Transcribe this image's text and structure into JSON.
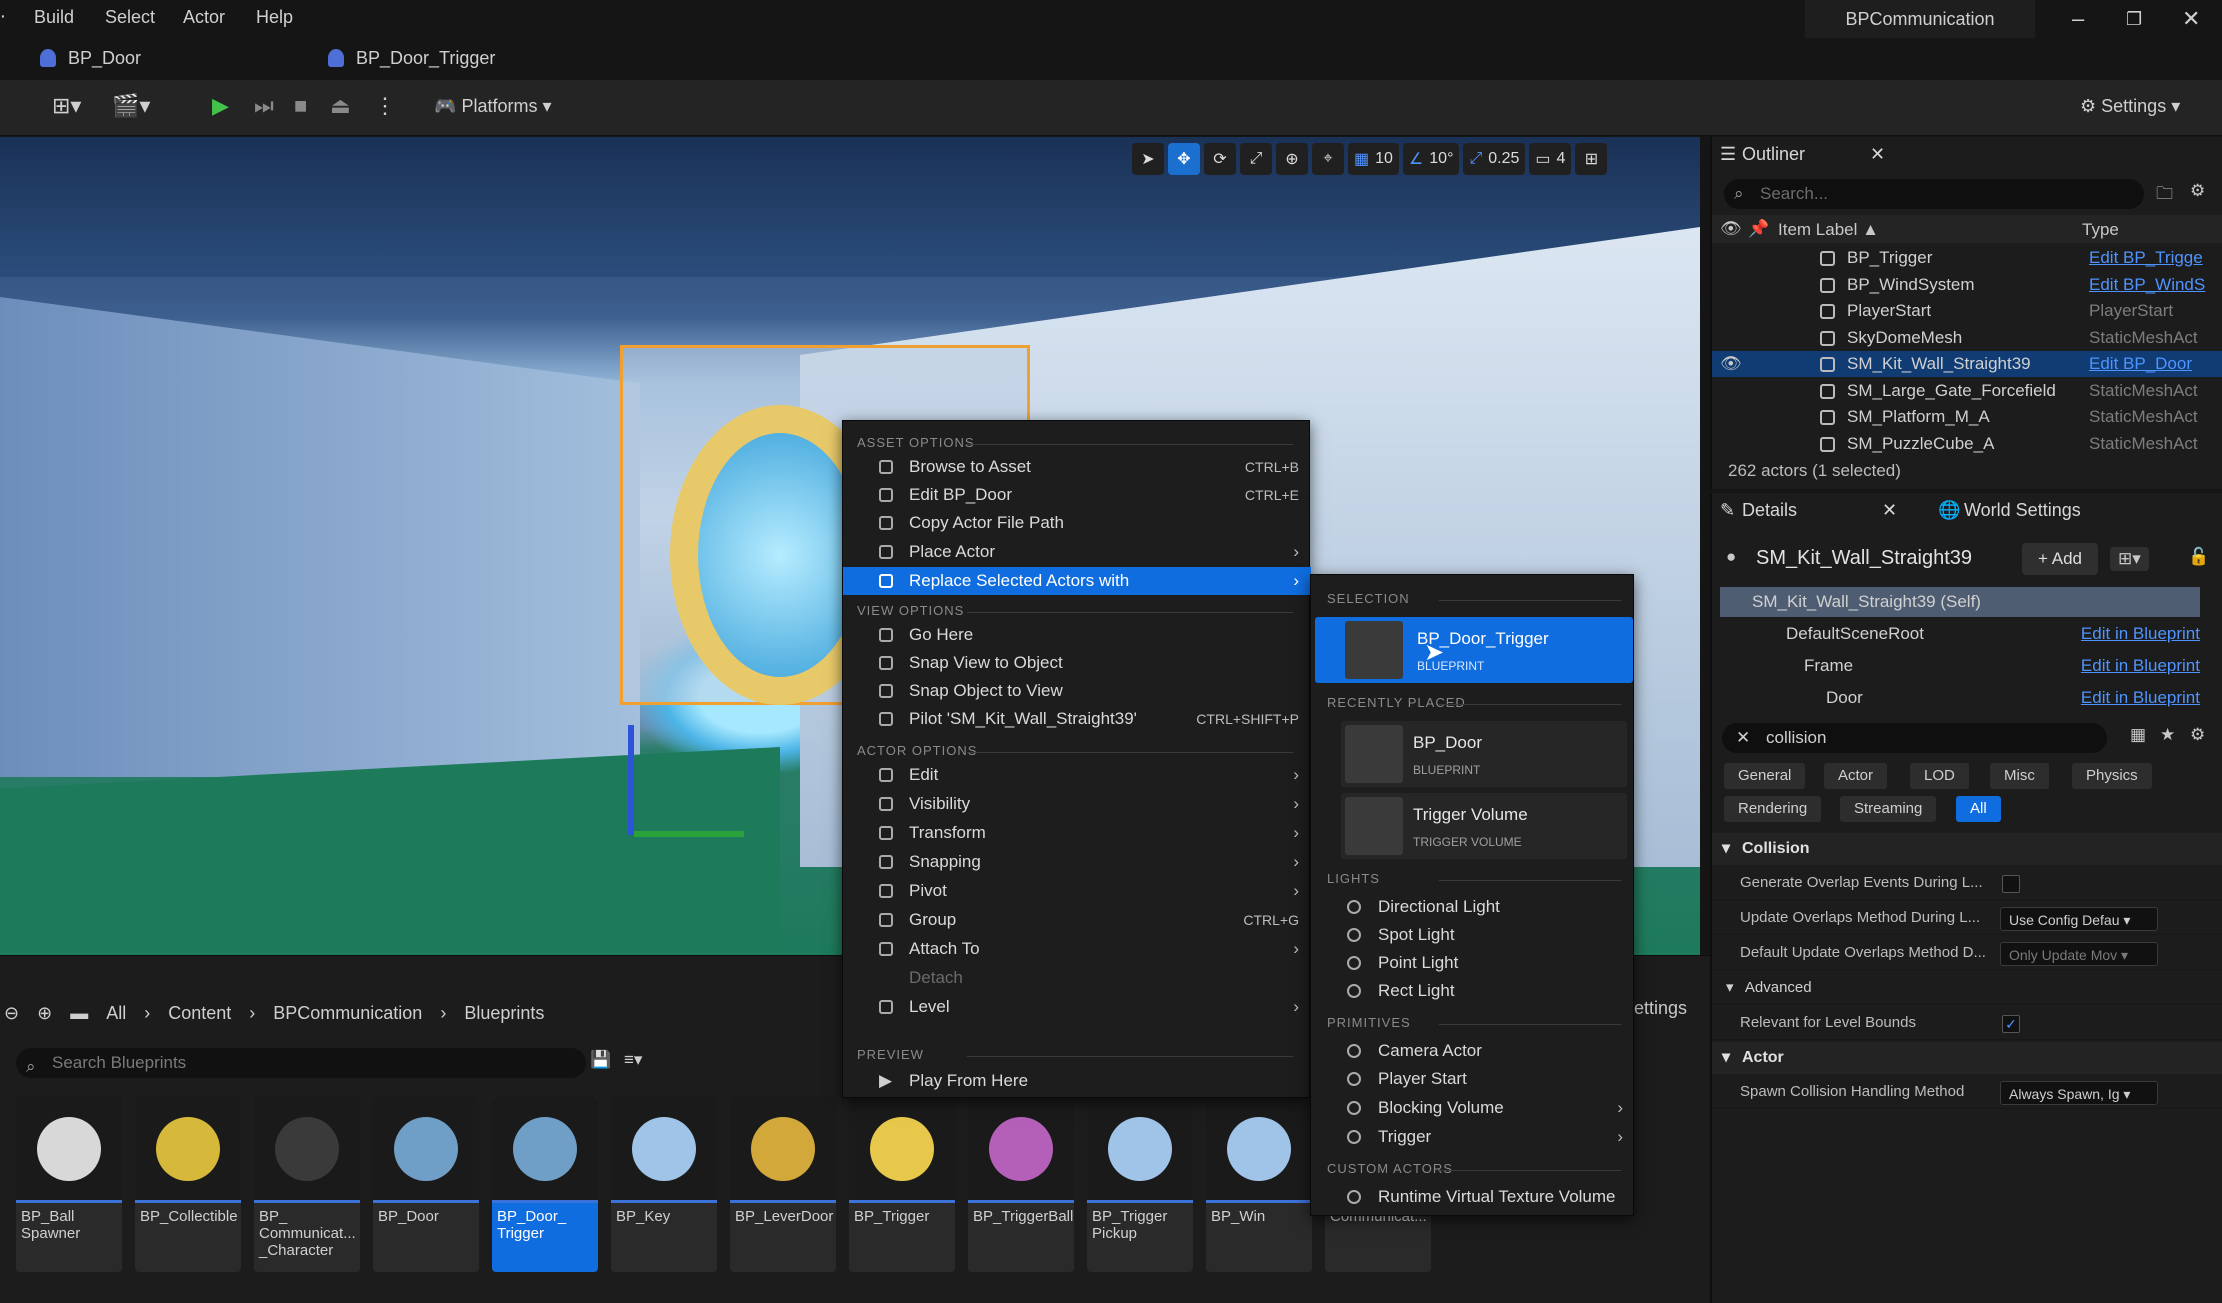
{
  "menubar": {
    "items": [
      "Build",
      "Select",
      "Actor",
      "Help"
    ],
    "project": "BPCommunication"
  },
  "tabs": [
    "BP_Door",
    "BP_Door_Trigger"
  ],
  "toolbar": {
    "platforms": "Platforms",
    "settings": "Settings"
  },
  "viewport_controls": {
    "grid": "10",
    "rotation": "10°",
    "scale": "0.25",
    "camera_speed": "4"
  },
  "context_menu": {
    "sections": {
      "asset": "ASSET OPTIONS",
      "view": "VIEW OPTIONS",
      "actor": "ACTOR OPTIONS",
      "preview": "PREVIEW"
    },
    "asset_items": [
      {
        "label": "Browse to Asset",
        "shortcut": "CTRL+B"
      },
      {
        "label": "Edit BP_Door",
        "shortcut": "CTRL+E"
      },
      {
        "label": "Copy Actor File Path",
        "shortcut": ""
      },
      {
        "label": "Place Actor",
        "shortcut": ""
      },
      {
        "label": "Replace Selected Actors with",
        "shortcut": ""
      }
    ],
    "view_items": [
      {
        "label": "Go Here",
        "shortcut": ""
      },
      {
        "label": "Snap View to Object",
        "shortcut": ""
      },
      {
        "label": "Snap Object to View",
        "shortcut": ""
      },
      {
        "label": "Pilot 'SM_Kit_Wall_Straight39'",
        "shortcut": "CTRL+SHIFT+P"
      }
    ],
    "actor_items": [
      {
        "label": "Edit",
        "shortcut": ""
      },
      {
        "label": "Visibility",
        "shortcut": ""
      },
      {
        "label": "Transform",
        "shortcut": ""
      },
      {
        "label": "Snapping",
        "shortcut": ""
      },
      {
        "label": "Pivot",
        "shortcut": ""
      },
      {
        "label": "Group",
        "shortcut": "CTRL+G"
      },
      {
        "label": "Attach To",
        "shortcut": ""
      },
      {
        "label": "Detach",
        "shortcut": ""
      },
      {
        "label": "Level",
        "shortcut": ""
      }
    ],
    "preview_items": [
      {
        "label": "Play From Here"
      }
    ]
  },
  "submenu": {
    "sections": {
      "selection": "SELECTION",
      "recent": "RECENTLY PLACED",
      "lights": "LIGHTS",
      "primitives": "PRIMITIVES",
      "custom": "CUSTOM ACTORS"
    },
    "selection_card": {
      "title": "BP_Door_Trigger",
      "sub": "BLUEPRINT"
    },
    "recent_cards": [
      {
        "title": "BP_Door",
        "sub": "BLUEPRINT"
      },
      {
        "title": "Trigger Volume",
        "sub": "TRIGGER VOLUME"
      }
    ],
    "lights": [
      "Directional Light",
      "Spot Light",
      "Point Light",
      "Rect Light"
    ],
    "primitives": [
      "Camera Actor",
      "Player Start",
      "Blocking Volume",
      "Trigger"
    ],
    "custom": [
      "Runtime Virtual Texture Volume"
    ]
  },
  "content_browser": {
    "breadcrumb": [
      "All",
      "Content",
      "BPCommunication",
      "Blueprints"
    ],
    "search_placeholder": "Search Blueprints",
    "settings_fragment": "ettings",
    "assets": [
      {
        "name": "BP_Ball Spawner",
        "color": "#d8d8d8"
      },
      {
        "name": "BP_Collectible",
        "color": "#d6b83a"
      },
      {
        "name": "BP_ Communicat... _Character",
        "color": "#3a3a3a"
      },
      {
        "name": "BP_Door",
        "color": "#6f9fc6"
      },
      {
        "name": "BP_Door_ Trigger",
        "color": "#6f9fc6"
      },
      {
        "name": "BP_Key",
        "color": "#9fc4e8"
      },
      {
        "name": "BP_LeverDoor",
        "color": "#d3a83a"
      },
      {
        "name": "BP_Trigger",
        "color": "#e7c84a"
      },
      {
        "name": "BP_TriggerBall",
        "color": "#b45fb8"
      },
      {
        "name": "BP_Trigger Pickup",
        "color": "#9fc4e8"
      },
      {
        "name": "BP_Win",
        "color": "#9fc4e8"
      },
      {
        "name": "Communicat...",
        "color": "#2a2a2a"
      }
    ]
  },
  "outliner": {
    "tab": "Outliner",
    "search_placeholder": "Search...",
    "col_label": "Item Label ▲",
    "col_type": "Type",
    "rows": [
      {
        "label": "BP_Trigger",
        "type": "Edit BP_Trigge",
        "link": true
      },
      {
        "label": "BP_WindSystem",
        "type": "Edit BP_WindS",
        "link": true
      },
      {
        "label": "PlayerStart",
        "type": "PlayerStart",
        "link": false
      },
      {
        "label": "SkyDomeMesh",
        "type": "StaticMeshAct",
        "link": false
      },
      {
        "label": "SM_Kit_Wall_Straight39",
        "type": "Edit BP_Door",
        "link": true
      },
      {
        "label": "SM_Large_Gate_Forcefield",
        "type": "StaticMeshAct",
        "link": false
      },
      {
        "label": "SM_Platform_M_A",
        "type": "StaticMeshAct",
        "link": false
      },
      {
        "label": "SM_PuzzleCube_A",
        "type": "StaticMeshAct",
        "link": false
      }
    ],
    "status": "262 actors (1 selected)"
  },
  "details": {
    "tab": "Details",
    "world_tab": "World Settings",
    "actor": "SM_Kit_Wall_Straight39",
    "add": "+ Add",
    "components": [
      {
        "label": "SM_Kit_Wall_Straight39 (Self)",
        "edit": ""
      },
      {
        "label": "DefaultSceneRoot",
        "edit": "Edit in Blueprint"
      },
      {
        "label": "Frame",
        "edit": "Edit in Blueprint"
      },
      {
        "label": "Door",
        "edit": "Edit in Blueprint"
      }
    ],
    "search_value": "collision",
    "filters": [
      "General",
      "Actor",
      "LOD",
      "Misc",
      "Physics",
      "Rendering",
      "Streaming",
      "All"
    ],
    "sections": {
      "collision": "Collision",
      "advanced": "Advanced",
      "actor": "Actor"
    },
    "props": [
      {
        "label": "Generate Overlap Events During L...",
        "value": ""
      },
      {
        "label": "Update Overlaps Method During L...",
        "value": "Use Config Defau ▾"
      },
      {
        "label": "Default Update Overlaps Method D...",
        "value": "Only Update Mov ▾"
      },
      {
        "label": "Relevant for Level Bounds",
        "value": "✓"
      },
      {
        "label": "Spawn Collision Handling Method",
        "value": "Always Spawn, Ig ▾"
      }
    ]
  }
}
